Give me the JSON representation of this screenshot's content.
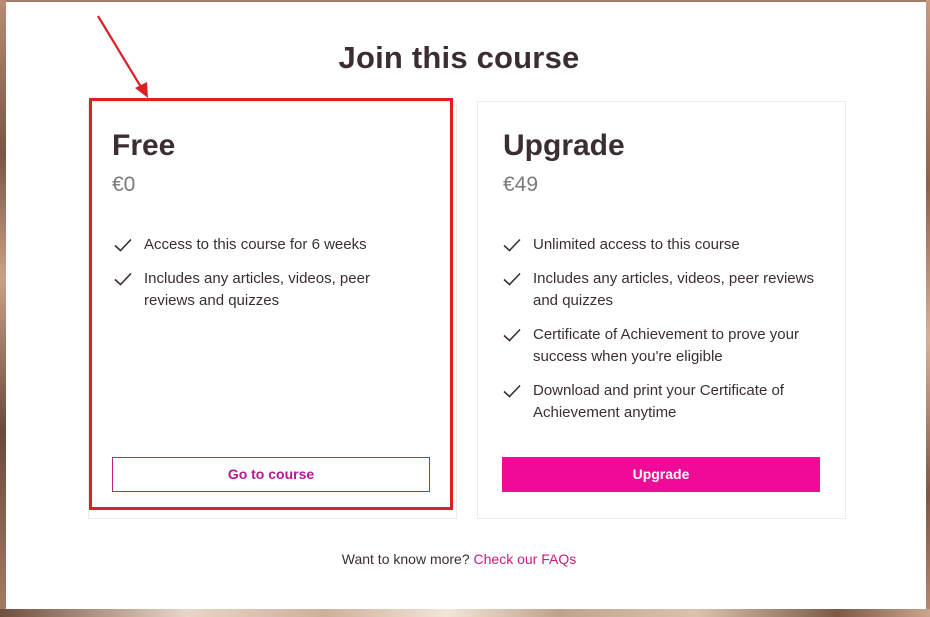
{
  "modal": {
    "title": "Join this course"
  },
  "plans": {
    "free": {
      "name": "Free",
      "price": "€0",
      "features": [
        "Access to this course for 6 weeks",
        "Includes any articles, videos, peer reviews and quizzes"
      ],
      "button_label": "Go to course"
    },
    "upgrade": {
      "name": "Upgrade",
      "price": "€49",
      "features": [
        "Unlimited access to this course",
        "Includes any articles, videos, peer reviews and quizzes",
        "Certificate of Achievement to prove your success when you're eligible",
        "Download and print your Certificate of Achievement anytime"
      ],
      "button_label": "Upgrade"
    }
  },
  "footer": {
    "text": "Want to know more?",
    "link_label": "Check our FAQs"
  },
  "colors": {
    "accent": "#ef0b97",
    "annotation": "#dd1f26",
    "text": "#3a2e33"
  },
  "icons": {
    "feature": "check-icon",
    "annotation": "red-arrow"
  }
}
